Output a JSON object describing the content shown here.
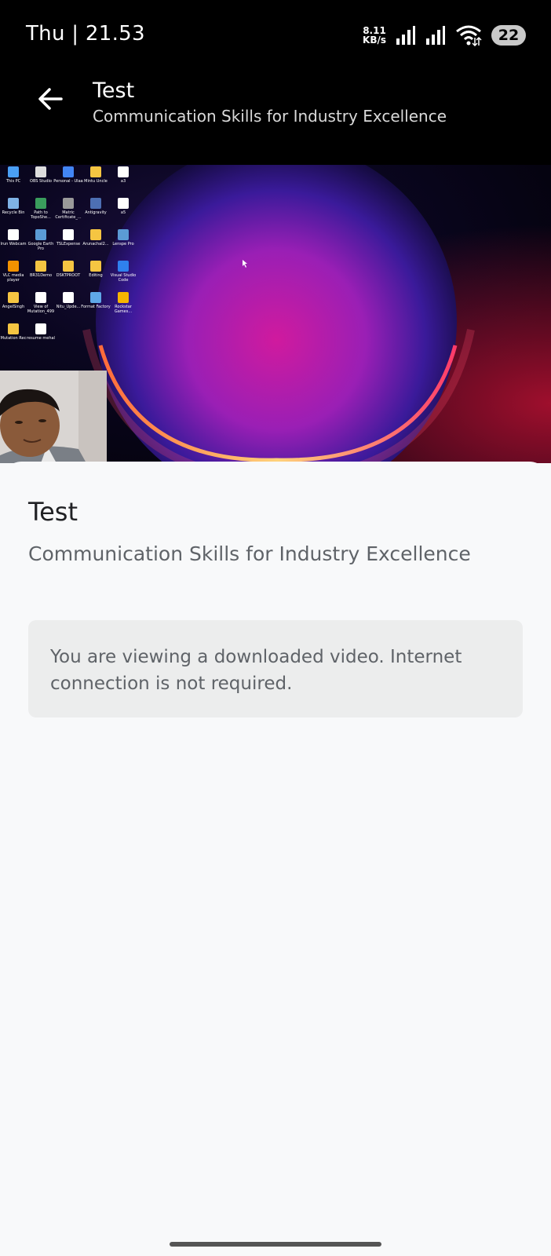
{
  "status_bar": {
    "time": "Thu | 21.53",
    "net_speed_value": "8.11",
    "net_speed_unit": "KB/s",
    "battery": "22"
  },
  "header": {
    "title": "Test",
    "subtitle": "Communication Skills for Industry Excellence"
  },
  "video": {
    "desktop_icons": [
      {
        "label": "This PC",
        "color": "#4a9ff5"
      },
      {
        "label": "OBS Studio",
        "color": "#dddddd"
      },
      {
        "label": "Personal - Ulaa",
        "color": "#4285f4"
      },
      {
        "label": "Mintu Uncle",
        "color": "#f5c542"
      },
      {
        "label": "a3",
        "color": "#ffffff"
      },
      {
        "label": "Recycle Bin",
        "color": "#7fb3e6"
      },
      {
        "label": "Path to TopoShe...",
        "color": "#3a9d5d"
      },
      {
        "label": "Matric Certificate_...",
        "color": "#9a9a9a"
      },
      {
        "label": "Antigravity",
        "color": "#4d6fb3"
      },
      {
        "label": "a5",
        "color": "#ffffff"
      },
      {
        "label": "Irun Webcam",
        "color": "#ffffff"
      },
      {
        "label": "Google Earth Pro",
        "color": "#5b9bd5"
      },
      {
        "label": "TSLExpense",
        "color": "#ffffff"
      },
      {
        "label": "Arunachal2...",
        "color": "#f5c542"
      },
      {
        "label": "Lenspe Pro",
        "color": "#5b9bd5"
      },
      {
        "label": "VLC media player",
        "color": "#f39200"
      },
      {
        "label": "BR31Demo",
        "color": "#f5c542"
      },
      {
        "label": "DSKTPROOT",
        "color": "#f5c542"
      },
      {
        "label": "Editing",
        "color": "#f5c542"
      },
      {
        "label": "Visual Studio Code",
        "color": "#2f80ed"
      },
      {
        "label": "AngelSingh",
        "color": "#f5c542"
      },
      {
        "label": "View of Mutation_499",
        "color": "#ffffff"
      },
      {
        "label": "Nitu_Upde...",
        "color": "#ffffff"
      },
      {
        "label": "Format Factory",
        "color": "#5fa8e8"
      },
      {
        "label": "Rockstar Games...",
        "color": "#f7b500"
      },
      {
        "label": "Mutation Rec",
        "color": "#f5c542"
      },
      {
        "label": "resume mehal",
        "color": "#ffffff"
      }
    ]
  },
  "content": {
    "title": "Test",
    "subtitle": "Communication Skills for Industry Excellence",
    "notice": "You are viewing a downloaded video. Internet connection is not required."
  }
}
